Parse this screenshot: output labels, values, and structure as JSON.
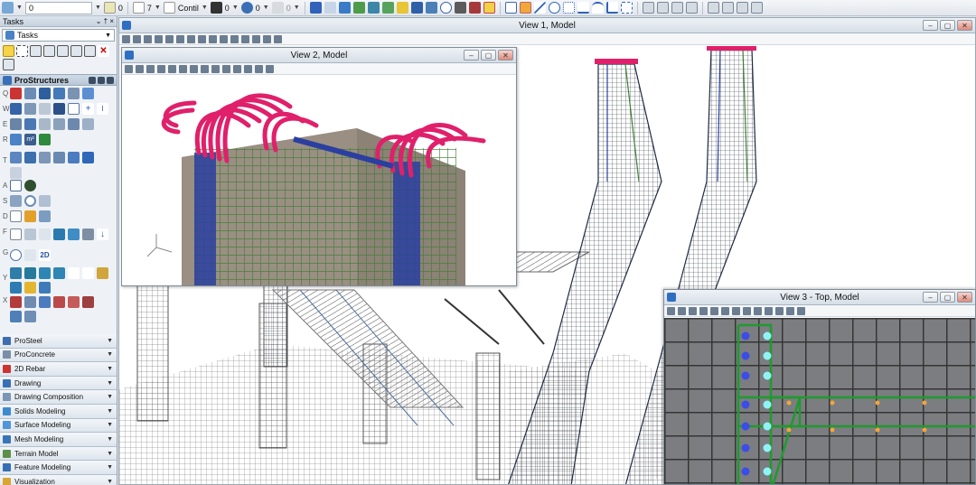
{
  "topbar": {
    "active_level_value": "0",
    "color_value": "0",
    "weight_value": "7",
    "line_style_value": "Contil",
    "transparency_value": "0",
    "priority_value": "0",
    "class_value": "0"
  },
  "tasks": {
    "title": "Tasks",
    "pin": "⌄ † ×",
    "selected_task": "Tasks",
    "prostructures_label": "ProStructures",
    "row_letters": [
      "Q",
      "W",
      "E",
      "R",
      "T",
      "A",
      "S",
      "D",
      "F",
      "G",
      "Y",
      "X"
    ],
    "sections": [
      {
        "label": "ProSteel"
      },
      {
        "label": "ProConcrete"
      },
      {
        "label": "2D Rebar"
      },
      {
        "label": "Drawing"
      },
      {
        "label": "Drawing Composition"
      },
      {
        "label": "Solids Modeling"
      },
      {
        "label": "Surface Modeling"
      },
      {
        "label": "Mesh Modeling"
      },
      {
        "label": "Terrain Model"
      },
      {
        "label": "Feature Modeling"
      },
      {
        "label": "Visualization"
      }
    ]
  },
  "view1": {
    "title": "View 1, Model"
  },
  "view2": {
    "title": "View 2, Model"
  },
  "view3": {
    "title": "View 3 - Top, Model"
  },
  "colors": {
    "rebar_pink": "#e0206a",
    "rebar_green": "#3f7f34",
    "rebar_blue": "#2a3fa0",
    "concrete": "#8c8276",
    "grid": "#3d3d3d",
    "plan_green": "#1f9a2e",
    "dot_blue": "#3b4de6",
    "dot_cyan": "#8ff3f6",
    "dot_orange": "#f4a43b"
  }
}
